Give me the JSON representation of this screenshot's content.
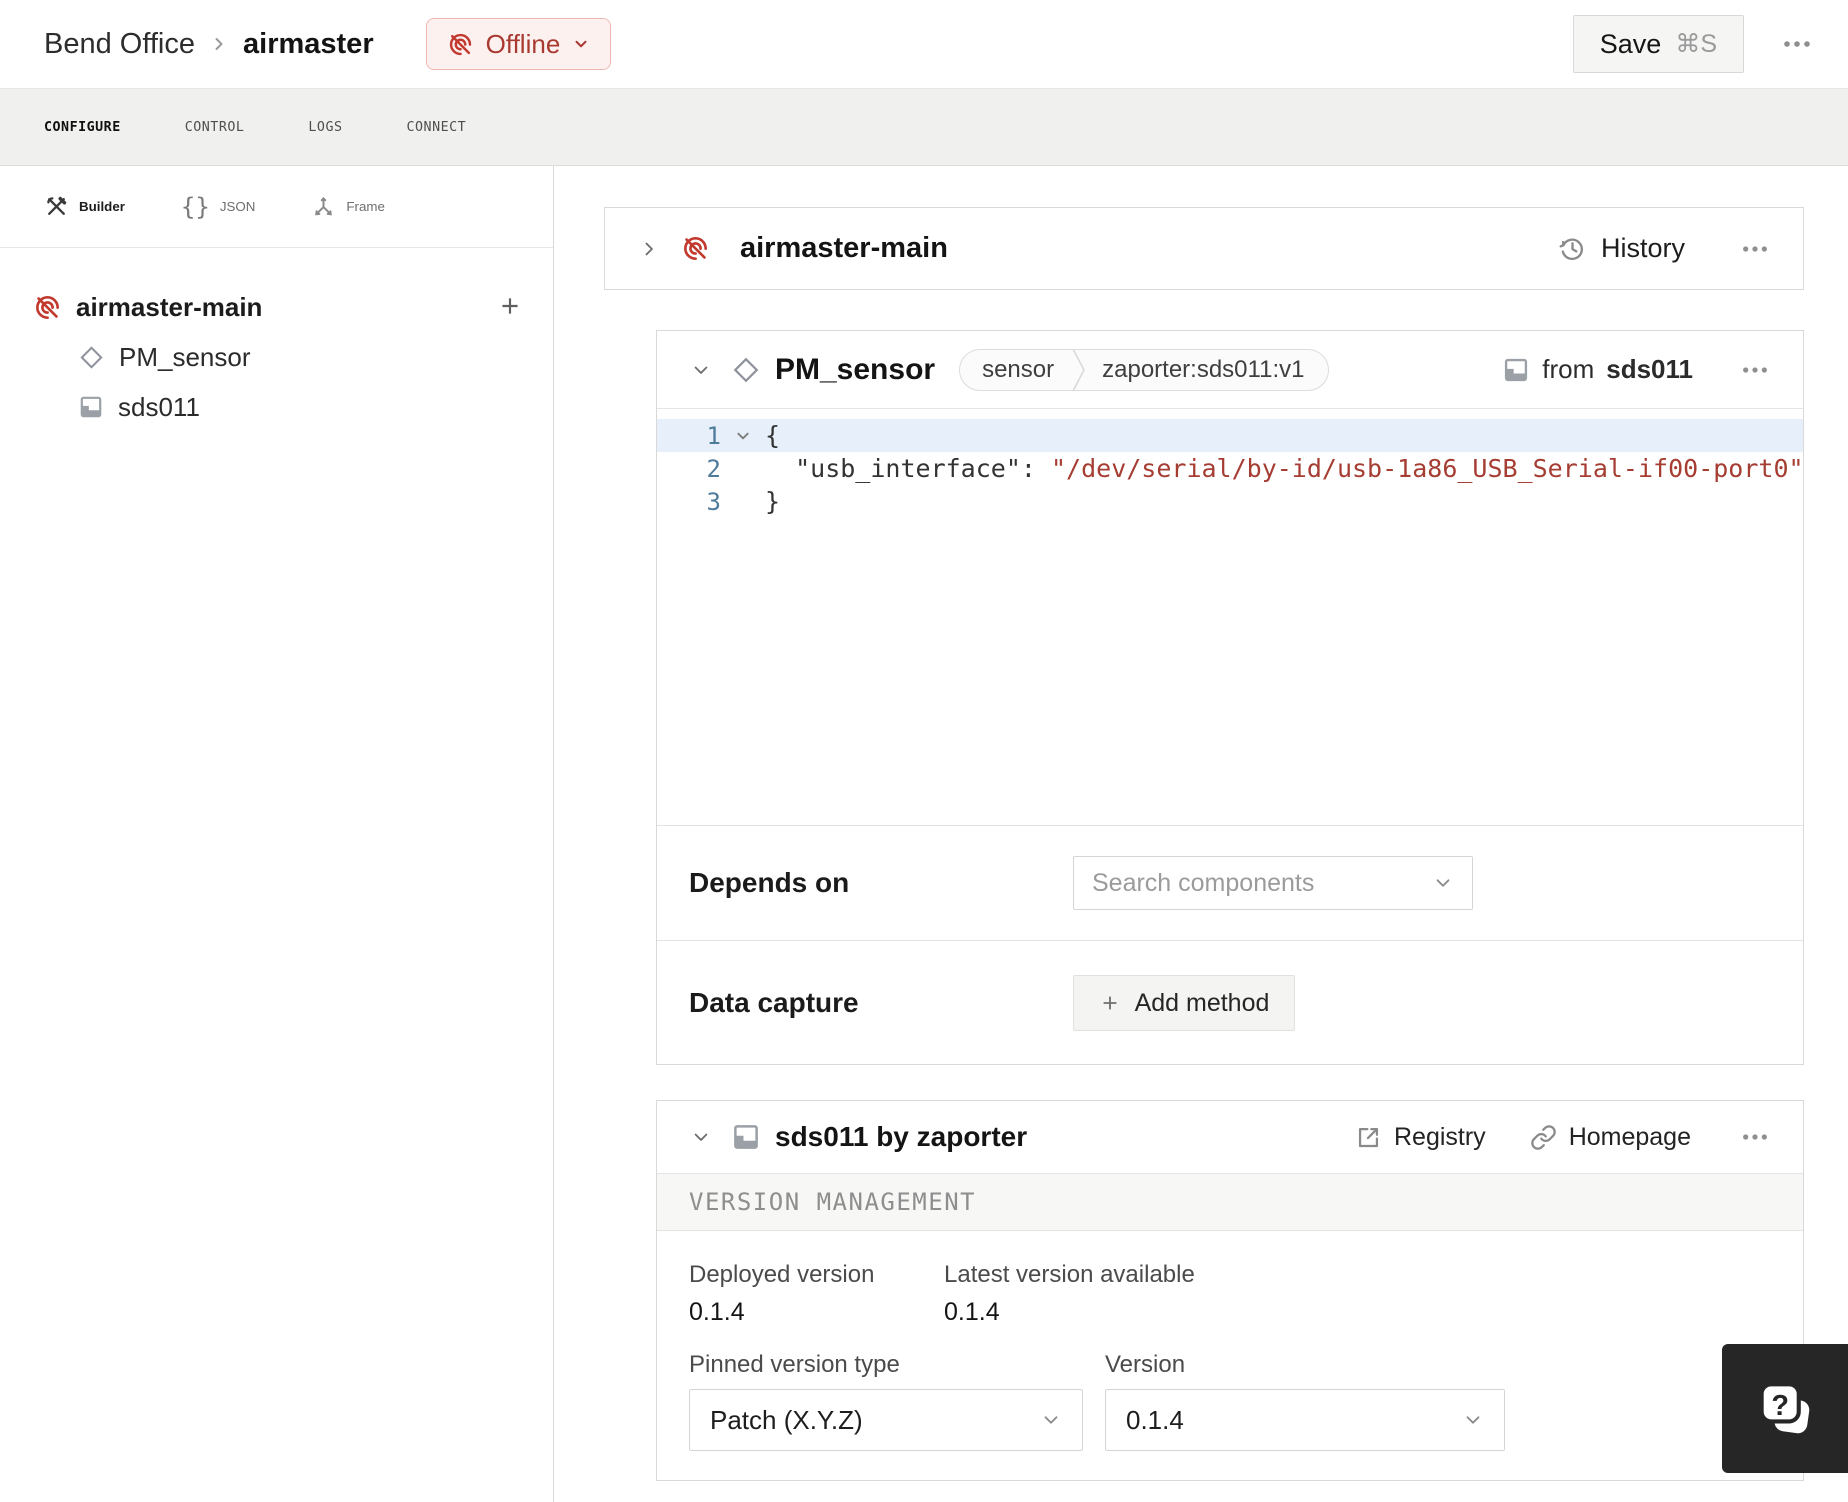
{
  "header": {
    "breadcrumb": {
      "org": "Bend Office",
      "machine": "airmaster"
    },
    "status_label": "Offline",
    "save_label": "Save",
    "save_shortcut": "⌘S"
  },
  "tabs": [
    {
      "label": "CONFIGURE",
      "active": true
    },
    {
      "label": "CONTROL",
      "active": false
    },
    {
      "label": "LOGS",
      "active": false
    },
    {
      "label": "CONNECT",
      "active": false
    }
  ],
  "sidebar": {
    "views": [
      {
        "label": "Builder",
        "icon": "tools-icon",
        "active": true
      },
      {
        "label": "JSON",
        "icon": "braces-icon",
        "active": false
      },
      {
        "label": "Frame",
        "icon": "frame-axes-icon",
        "active": false
      }
    ],
    "tree": {
      "root_label": "airmaster-main",
      "children": [
        {
          "label": "PM_sensor",
          "icon": "diamond-icon"
        },
        {
          "label": "sds011",
          "icon": "module-icon"
        }
      ]
    }
  },
  "main": {
    "machine_card": {
      "title": "airmaster-main",
      "history_label": "History"
    },
    "component_card": {
      "title": "PM_sensor",
      "type_badge": "sensor",
      "model_badge": "zaporter:sds011:v1",
      "from_label": "from",
      "from_module": "sds011",
      "editor": {
        "lines": [
          {
            "num": "1",
            "text": "{"
          },
          {
            "num": "2",
            "key": "  \"usb_interface\": ",
            "value": "\"/dev/serial/by-id/usb-1a86_USB_Serial-if00-port0\""
          },
          {
            "num": "3",
            "text": "}"
          }
        ]
      },
      "depends": {
        "label": "Depends on",
        "placeholder": "Search components"
      },
      "capture": {
        "label": "Data capture",
        "button_label": "Add method"
      }
    },
    "module_card": {
      "title": "sds011 by zaporter",
      "registry_label": "Registry",
      "homepage_label": "Homepage",
      "section_title": "VERSION MANAGEMENT",
      "deployed_label": "Deployed version",
      "deployed_value": "0.1.4",
      "latest_label": "Latest version available",
      "latest_value": "0.1.4",
      "pinned_label": "Pinned version type",
      "pinned_value": "Patch (X.Y.Z)",
      "version_label": "Version",
      "version_value": "0.1.4"
    }
  },
  "help": {
    "glyph": "?"
  },
  "colors": {
    "offline_red": "#c23a2f",
    "offline_text": "#a93a31",
    "offline_bg": "#fdf1f0",
    "offline_border": "#eeb9b3",
    "code_string_red": "#a63d33",
    "line_number_blue": "#4e7b9a",
    "active_line_bg": "#e7f0fa",
    "tabbar_bg": "#f0f0ee",
    "help_bg": "#262626"
  }
}
